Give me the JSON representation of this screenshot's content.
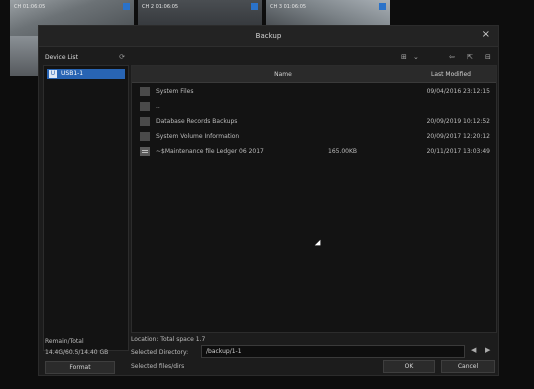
{
  "background": {
    "cameras": [
      {
        "caption": "CH 01:06:05",
        "caption2": ""
      },
      {
        "caption": "CH 2 01:06:05",
        "caption2": ""
      },
      {
        "caption": "CH 3 01:06:05",
        "caption2": ""
      }
    ]
  },
  "dialog": {
    "title": "Backup",
    "close_icon": "×"
  },
  "device_panel": {
    "header": "Device List",
    "refresh_icon": "⟳",
    "devices": [
      {
        "name": "USB1-1",
        "icon": "U"
      }
    ]
  },
  "toolbar": {
    "icons": [
      "⊞",
      "⌄",
      "⇦",
      "⇱",
      "⊟"
    ]
  },
  "file_table": {
    "columns": {
      "name": "Name",
      "date": "Last Modified"
    },
    "rows": [
      {
        "icon": "folder",
        "name": "System Files",
        "size": "",
        "date": "09/04/2016 23:12:15"
      },
      {
        "icon": "folder",
        "name": "..",
        "size": "",
        "date": ""
      },
      {
        "icon": "folder",
        "name": "Database Records Backups",
        "size": "",
        "date": "20/09/2019 10:12:52"
      },
      {
        "icon": "folder",
        "name": "System Volume Information",
        "size": "",
        "date": "20/09/2017 12:20:12"
      },
      {
        "icon": "file",
        "name": "~$Maintenance file Ledger 06 2017",
        "size": "165.00KB",
        "date": "20/11/2017 13:03:49"
      }
    ]
  },
  "free_space": "Location: Total space 1.7",
  "path": {
    "label": "Selected Directory:",
    "value": "/backup/1-1"
  },
  "nav": {
    "prev": "◀",
    "next": "▶"
  },
  "selected_info": "Selected files/dirs",
  "remaining": {
    "label": "Remain/Total",
    "value": "14.4G/60.5/14.40 GB"
  },
  "buttons": {
    "format": "Format",
    "ok": "OK",
    "cancel": "Cancel"
  }
}
